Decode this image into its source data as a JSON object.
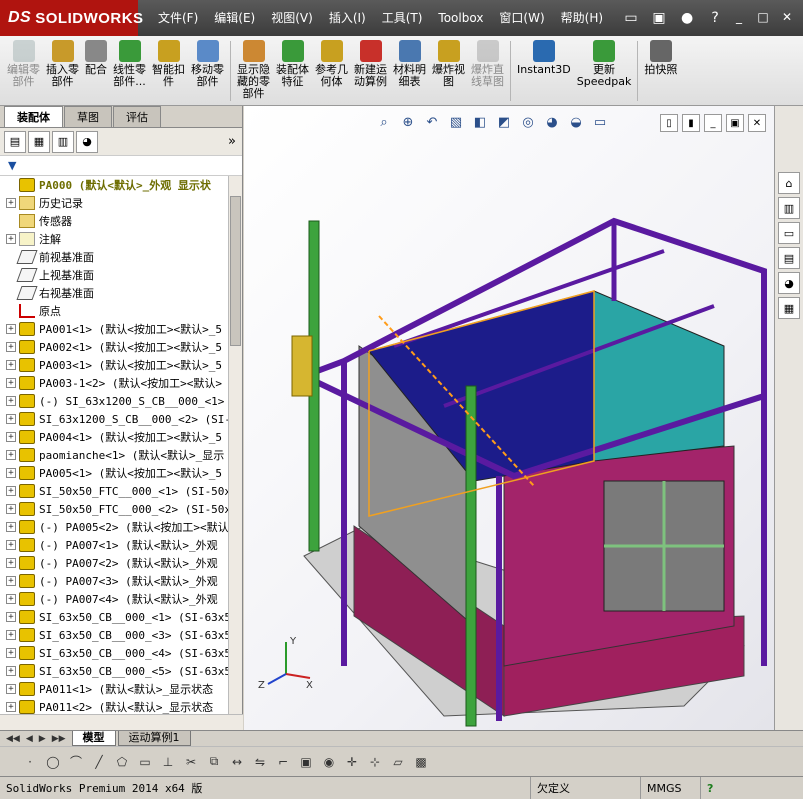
{
  "app": {
    "brand": "SOLIDWORKS",
    "brand_prefix": "DS"
  },
  "menu": [
    "文件(F)",
    "编辑(E)",
    "视图(V)",
    "插入(I)",
    "工具(T)",
    "Toolbox",
    "窗口(W)",
    "帮助(H)"
  ],
  "ribbon": [
    {
      "label": "编辑零\n部件",
      "disabled": true
    },
    {
      "label": "插入零\n部件",
      "disabled": false
    },
    {
      "label": "配合",
      "disabled": false
    },
    {
      "label": "线性零\n部件...",
      "disabled": false
    },
    {
      "label": "智能扣\n件",
      "disabled": false
    },
    {
      "label": "移动零\n部件",
      "disabled": false
    },
    {
      "label": "显示隐\n藏的零\n部件",
      "disabled": false
    },
    {
      "label": "装配体\n特征",
      "disabled": false
    },
    {
      "label": "参考几\n何体",
      "disabled": false
    },
    {
      "label": "新建运\n动算例",
      "disabled": false
    },
    {
      "label": "材料明\n细表",
      "disabled": false
    },
    {
      "label": "爆炸视\n图",
      "disabled": false
    },
    {
      "label": "爆炸直\n线草图",
      "disabled": true
    },
    {
      "label": "Instant3D",
      "disabled": false
    },
    {
      "label": "更新\nSpeedpak",
      "disabled": false
    },
    {
      "label": "拍快照",
      "disabled": false
    }
  ],
  "panel_tabs": [
    "装配体",
    "草图",
    "评估"
  ],
  "tree": [
    {
      "text": "PA000  (默认<默认>_外观 显示状",
      "icon": "part",
      "exp": "none",
      "root": true
    },
    {
      "text": "历史记录",
      "icon": "folder",
      "exp": "plus"
    },
    {
      "text": "传感器",
      "icon": "folder",
      "exp": "none"
    },
    {
      "text": "注解",
      "icon": "note",
      "exp": "plus"
    },
    {
      "text": "前视基准面",
      "icon": "plane",
      "exp": "none"
    },
    {
      "text": "上视基准面",
      "icon": "plane",
      "exp": "none"
    },
    {
      "text": "右视基准面",
      "icon": "plane",
      "exp": "none"
    },
    {
      "text": "原点",
      "icon": "origin",
      "exp": "none"
    },
    {
      "text": "PA001<1> (默认<按加工><默认>_5",
      "icon": "part",
      "exp": "plus"
    },
    {
      "text": "PA002<1> (默认<按加工><默认>_5",
      "icon": "part",
      "exp": "plus"
    },
    {
      "text": "PA003<1> (默认<按加工><默认>_5",
      "icon": "part",
      "exp": "plus"
    },
    {
      "text": "PA003-1<2> (默认<按加工><默认>",
      "icon": "part",
      "exp": "plus"
    },
    {
      "text": "(-) SI_63x1200_S_CB__000_<1> (S",
      "icon": "part",
      "exp": "plus"
    },
    {
      "text": "SI_63x1200_S_CB__000_<2> (SI-63",
      "icon": "part",
      "exp": "plus"
    },
    {
      "text": "PA004<1> (默认<按加工><默认>_5",
      "icon": "part",
      "exp": "plus"
    },
    {
      "text": "paomianche<1> (默认<默认>_显示",
      "icon": "part",
      "exp": "plus"
    },
    {
      "text": "PA005<1> (默认<按加工><默认>_5",
      "icon": "part",
      "exp": "plus"
    },
    {
      "text": "SI_50x50_FTC__000_<1> (SI-50x50",
      "icon": "part",
      "exp": "plus"
    },
    {
      "text": "SI_50x50_FTC__000_<2> (SI-50x50",
      "icon": "part",
      "exp": "plus"
    },
    {
      "text": "(-) PA005<2> (默认<按加工><默认",
      "icon": "part",
      "exp": "plus"
    },
    {
      "text": "(-) PA007<1> (默认<默认>_外观",
      "icon": "part",
      "exp": "plus"
    },
    {
      "text": "(-) PA007<2> (默认<默认>_外观",
      "icon": "part",
      "exp": "plus"
    },
    {
      "text": "(-) PA007<3> (默认<默认>_外观",
      "icon": "part",
      "exp": "plus"
    },
    {
      "text": "(-) PA007<4> (默认<默认>_外观",
      "icon": "part",
      "exp": "plus"
    },
    {
      "text": "SI_63x50_CB__000_<1> (SI-63x50-",
      "icon": "part",
      "exp": "plus"
    },
    {
      "text": "SI_63x50_CB__000_<3> (SI-63x50-",
      "icon": "part",
      "exp": "plus"
    },
    {
      "text": "SI_63x50_CB__000_<4> (SI-63x50-",
      "icon": "part",
      "exp": "plus"
    },
    {
      "text": "SI_63x50_CB__000_<5> (SI-63x50-",
      "icon": "part",
      "exp": "plus"
    },
    {
      "text": "PA011<1> (默认<默认>_显示状态",
      "icon": "part",
      "exp": "plus"
    },
    {
      "text": "PA011<2> (默认<默认>_显示状态",
      "icon": "part",
      "exp": "plus"
    }
  ],
  "bottom_tabs": [
    "模型",
    "运动算例1"
  ],
  "triad": {
    "x": "X",
    "y": "Y",
    "z": "Z"
  },
  "status": {
    "app": "SolidWorks Premium 2014 x64 版",
    "state": "欠定义",
    "units": "MMGS",
    "help": "?"
  }
}
